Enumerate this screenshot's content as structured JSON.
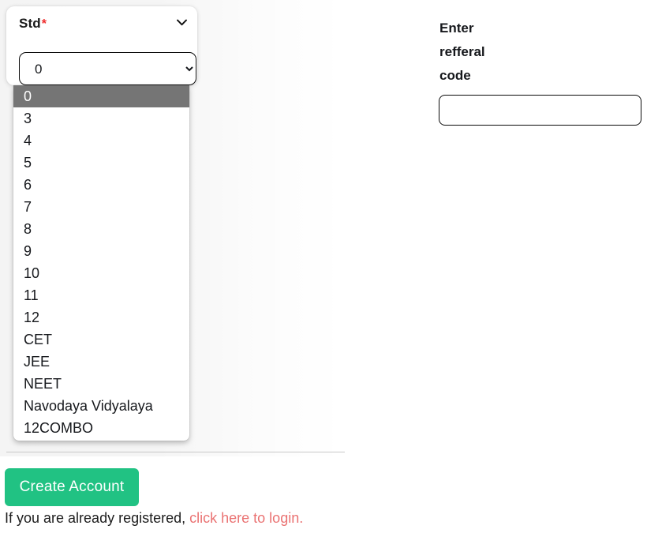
{
  "colors": {
    "accent_green": "#21c283",
    "link_red": "#ea7272",
    "required_star": "#ef2b2b",
    "option_highlight": "#757575",
    "input_border": "#0b0b0b"
  },
  "std_field": {
    "label": "Std",
    "required_marker": "*",
    "selected_value": "0",
    "dropdown_open": true,
    "chevron_icon": "chevron-down-icon",
    "options": [
      {
        "label": "0",
        "selected": true
      },
      {
        "label": "3",
        "selected": false
      },
      {
        "label": "4",
        "selected": false
      },
      {
        "label": "5",
        "selected": false
      },
      {
        "label": "6",
        "selected": false
      },
      {
        "label": "7",
        "selected": false
      },
      {
        "label": "8",
        "selected": false
      },
      {
        "label": "9",
        "selected": false
      },
      {
        "label": "10",
        "selected": false
      },
      {
        "label": "11",
        "selected": false
      },
      {
        "label": "12",
        "selected": false
      },
      {
        "label": "CET",
        "selected": false
      },
      {
        "label": "JEE",
        "selected": false
      },
      {
        "label": "NEET",
        "selected": false
      },
      {
        "label": "Navodaya Vidyalaya",
        "selected": false
      },
      {
        "label": "12COMBO",
        "selected": false
      }
    ]
  },
  "referral_field": {
    "label": "Enter refferal code",
    "value": "",
    "placeholder": ""
  },
  "footer": {
    "submit_label": "Create Account",
    "login_prompt": "If you are already registered,",
    "login_link_label": "click here to login",
    "login_period": "."
  }
}
